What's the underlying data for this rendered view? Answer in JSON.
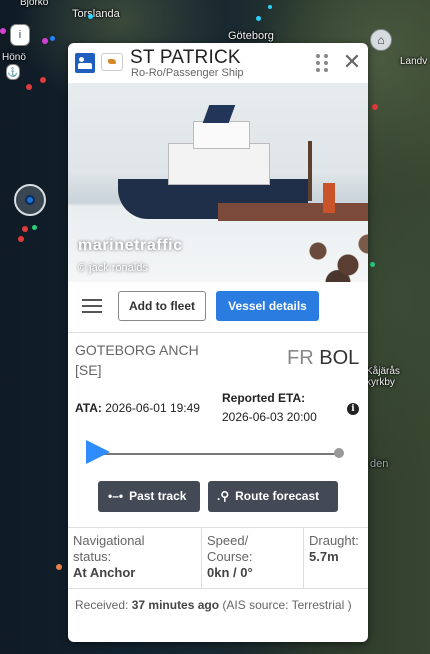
{
  "map": {
    "labels": {
      "torslanda": "Torslanda",
      "goteborg": "Göteborg",
      "hono": "Hönö",
      "bjorko": "Björkö",
      "landvetter": "Landv",
      "jaras": "Kåjärås kyrkby",
      "den": "den"
    }
  },
  "vessel": {
    "name": "ST PATRICK",
    "type": "Ro-Ro/Passenger Ship",
    "flag_color": "#d48a2a",
    "type_icon_color": "#1f5fbf"
  },
  "photo": {
    "watermark": "marinetraffic",
    "credit": "© jack ronalds"
  },
  "actions": {
    "add_to_fleet": "Add to fleet",
    "vessel_details": "Vessel details",
    "accent_color": "#2b7ce0"
  },
  "voyage": {
    "destination_line1": "GOTEBORG ANCH",
    "destination_line2": "[SE]",
    "dest_code_prefix": "FR",
    "dest_code": "BOL",
    "ata_label": "ATA:",
    "ata_value": "2026-06-01 19:49",
    "eta_label": "Reported ETA:",
    "eta_value": "2026-06-03 20:00",
    "info_icon": "i"
  },
  "tracks": {
    "past_track": "Past track",
    "route_forecast": "Route forecast"
  },
  "status": {
    "nav_label_1": "Navigational",
    "nav_label_2": "status:",
    "nav_value": "At Anchor",
    "speed_label_1": "Speed/",
    "speed_label_2": "Course:",
    "speed_value": "0kn / 0°",
    "draught_label": "Draught:",
    "draught_value": "5.7m"
  },
  "received": {
    "label": "Received:",
    "value": "37 minutes ago",
    "source": "(AIS source: Terrestrial )"
  }
}
